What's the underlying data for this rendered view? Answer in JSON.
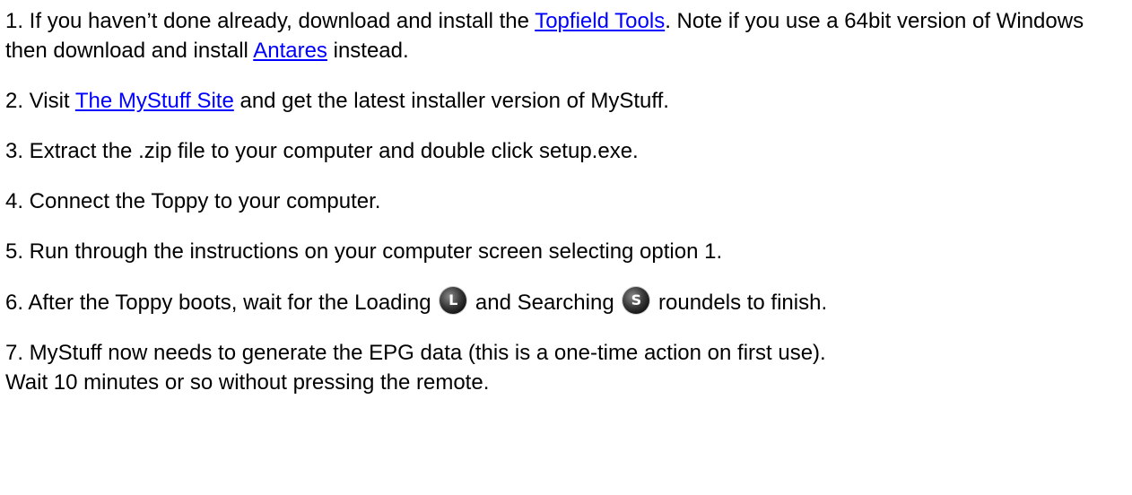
{
  "steps": {
    "s1": {
      "before": "1. If you haven’t done already, download and install the ",
      "link1": "Topfield Tools",
      "middle": ". Note if you use a 64bit version of Windows then download and install ",
      "link2": "Antares",
      "after": " instead."
    },
    "s2": {
      "before": "2. Visit ",
      "link": "The MyStuff Site",
      "after": " and get the latest installer version of MyStuff."
    },
    "s3": "3. Extract the .zip file to your computer and double click setup.exe.",
    "s4": "4. Connect the Toppy to your computer.",
    "s5": "5. Run through the instructions on your computer screen selecting option 1.",
    "s6": {
      "before": "6. After the Toppy boots, wait for the Loading ",
      "loading_icon_letter": "L",
      "middle": " and Searching ",
      "searching_icon_letter": "S",
      "after": " roundels to finish."
    },
    "s7": {
      "line1": "7. MyStuff now needs to generate the EPG data (this is a one-time action on first use).",
      "line2": "Wait 10 minutes or so without pressing the remote."
    }
  },
  "colors": {
    "link": "#0000ff",
    "text": "#000000",
    "background": "#ffffff"
  },
  "icons": {
    "loading": "loading-roundel-icon",
    "searching": "searching-roundel-icon"
  }
}
